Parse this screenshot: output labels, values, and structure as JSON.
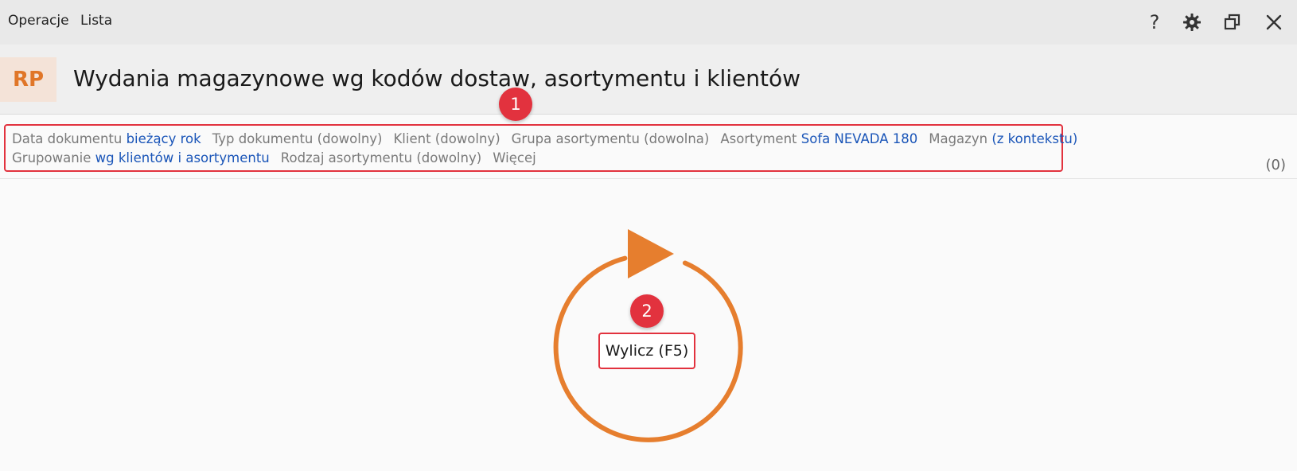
{
  "menu": {
    "items": [
      {
        "label": "Operacje"
      },
      {
        "label": "Lista"
      }
    ]
  },
  "window_controls": {
    "help": "?",
    "icons": [
      "gear-icon",
      "restore-icon",
      "close-icon"
    ]
  },
  "header": {
    "badge": "RP",
    "title": "Wydania magazynowe wg kodów dostaw, asortymentu i klientów"
  },
  "filters": {
    "row1": [
      {
        "label": "Data dokumentu",
        "value": "bieżący rok"
      },
      {
        "label": "Typ dokumentu (dowolny)",
        "value": ""
      },
      {
        "label": "Klient (dowolny)",
        "value": ""
      },
      {
        "label": "Grupa asortymentu (dowolna)",
        "value": ""
      },
      {
        "label": "Asortyment",
        "value": "Sofa NEVADA 180"
      },
      {
        "label": "Magazyn",
        "value": "(z kontekstu)"
      }
    ],
    "row2": [
      {
        "label": "Grupowanie",
        "value": "wg klientów i asortymentu"
      },
      {
        "label": "Rodzaj asortymentu (dowolny)",
        "value": ""
      },
      {
        "label": "Więcej",
        "value": ""
      }
    ]
  },
  "result_count": "(0)",
  "markers": [
    "1",
    "2"
  ],
  "calculate_button": "Wylicz (F5)",
  "colors": {
    "accent_orange": "#e67e2e",
    "marker_red": "#e2323e",
    "link_blue": "#1a55b8"
  }
}
